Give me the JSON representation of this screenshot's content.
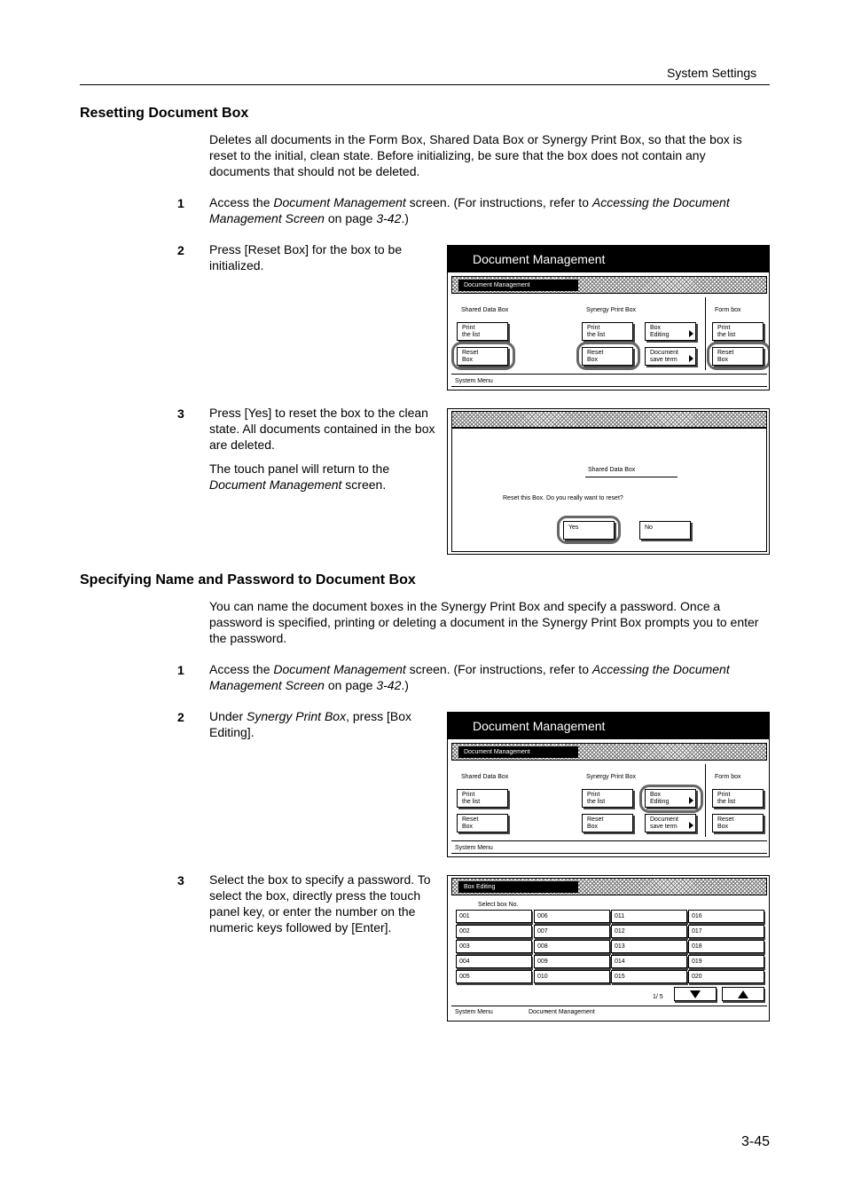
{
  "header": {
    "section": "System Settings"
  },
  "sec1": {
    "title": "Resetting Document Box",
    "intro": "Deletes all documents in the Form Box, Shared Data Box or Synergy Print Box, so that the box is reset to the initial, clean state. Before initializing, be sure that the box does not contain any documents that should not be deleted.",
    "step1": {
      "num": "1",
      "a": "Access the ",
      "b": "Document Management",
      "c": " screen. (For instructions, refer to ",
      "d": "Accessing the Document Management Screen",
      "e": " on page ",
      "f": "3-42",
      "g": ".)"
    },
    "step2": {
      "num": "2",
      "text": "Press [Reset Box] for the box to be initialized."
    },
    "step3": {
      "num": "3",
      "text": "Press [Yes] to reset the box to the clean state. All documents contained in the box are deleted.",
      "p2a": "The touch panel will return to the ",
      "p2b": "Document Management",
      "p2c": " screen."
    }
  },
  "sec2": {
    "title": "Specifying Name and Password to Document Box",
    "intro": "You can name the document boxes in the Synergy Print Box and specify a password. Once a password is specified, printing or deleting a document in the Synergy Print Box prompts you to enter the password.",
    "step1": {
      "num": "1",
      "a": "Access the ",
      "b": "Document Management",
      "c": " screen. (For instructions, refer to ",
      "d": "Accessing the Document Management Screen",
      "e": " on page ",
      "f": "3-42",
      "g": ".)"
    },
    "step2": {
      "num": "2",
      "a": "Under ",
      "b": "Synergy Print Box",
      "c": ", press [Box Editing]."
    },
    "step3": {
      "num": "3",
      "text": "Select the box to specify a password. To select the box, directly press the touch panel key, or enter the number on the numeric keys followed by [Enter]."
    }
  },
  "dm": {
    "title": "Document Management",
    "tab": "Document Management",
    "shared": "Shared Data Box",
    "synergy": "Synergy Print Box",
    "form": "Form box",
    "print_list": "Print\nthe list",
    "reset_box": "Reset\nBox",
    "box_editing": "Box\nEditing",
    "doc_save_term": "Document\nsave term",
    "footer": "System Menu"
  },
  "dialog": {
    "box_name": "Shared Data Box",
    "question": "Reset this Box. Do you really want to reset?",
    "yes": "Yes",
    "no": "No"
  },
  "boxedit": {
    "tab": "Box Editing",
    "select_label": "Select box No.",
    "boxes": [
      "001",
      "002",
      "003",
      "004",
      "005",
      "006",
      "007",
      "008",
      "009",
      "010",
      "011",
      "012",
      "013",
      "014",
      "015",
      "016",
      "017",
      "018",
      "019",
      "020"
    ],
    "page": "1/ 5",
    "footer_a": "System Menu",
    "footer_sep": "-",
    "footer_b": "Document Management"
  },
  "page_number": "3-45"
}
